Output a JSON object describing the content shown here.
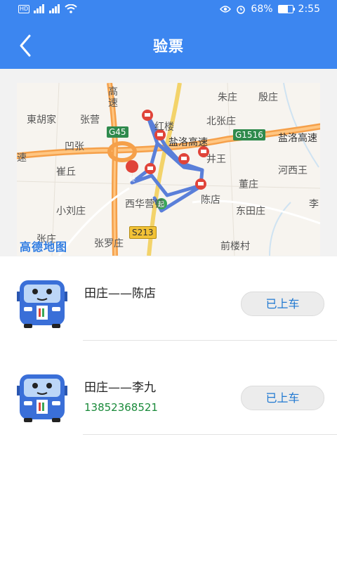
{
  "status_bar": {
    "left_badges": [
      "HD",
      "4G",
      "4G"
    ],
    "battery_percent": "68%",
    "battery_level": 0.68,
    "time": "2:55",
    "icons": [
      "eye-icon",
      "alarm-icon",
      "battery-icon",
      "wifi-icon",
      "signal-icon"
    ]
  },
  "header": {
    "title": "验票",
    "back_icon": "chevron-left-icon"
  },
  "map": {
    "logo": "高德地图",
    "place_labels": [
      "東胡家",
      "张营",
      "凹张",
      "崔丘",
      "小刘庄",
      "张庄",
      "张罗庄",
      "朱庄",
      "殷庄",
      "北张庄",
      "红楼",
      "井王",
      "河西王",
      "董庄",
      "陈店",
      "东田庄",
      "李",
      "西华营镇",
      "前楼村",
      "高",
      "速",
      "速"
    ],
    "road_names": [
      "盐洛高速",
      "盐洛高速"
    ],
    "road_badges": [
      "G45",
      "G1516",
      "S213"
    ],
    "markers": {
      "start": "起",
      "end": "终"
    }
  },
  "list": {
    "items": [
      {
        "route": "田庄——陈店",
        "phone": "",
        "button": "已上车",
        "icon": "bus-icon"
      },
      {
        "route": "田庄——李九",
        "phone": "13852368521",
        "button": "已上车",
        "icon": "bus-icon"
      }
    ]
  }
}
